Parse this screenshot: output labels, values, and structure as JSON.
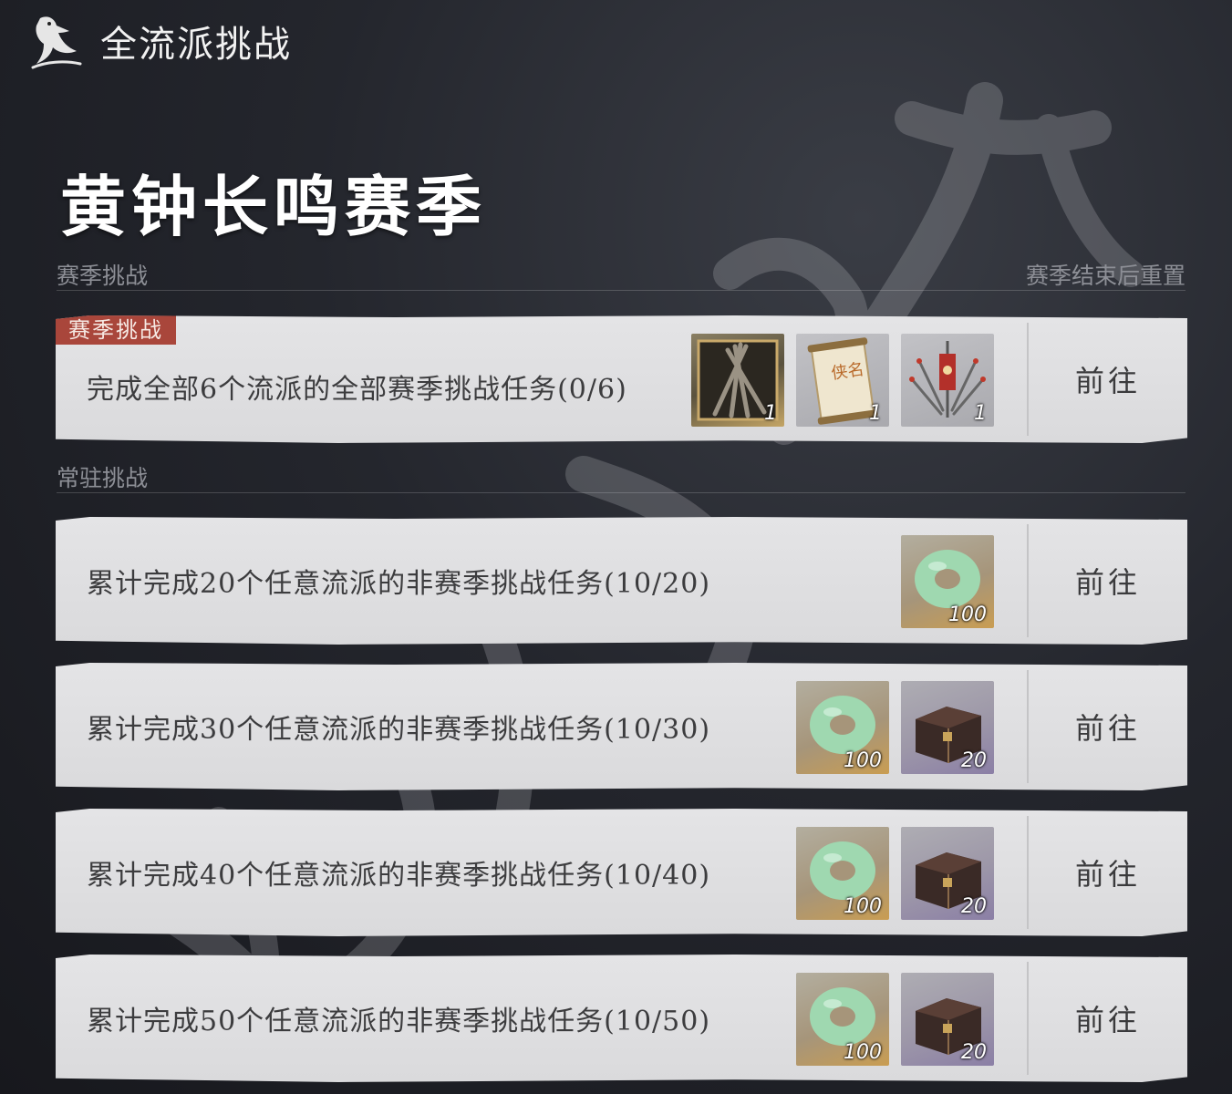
{
  "app": {
    "title": "全流派挑战",
    "logo_icon": "crow-logo-icon"
  },
  "season": {
    "title": "黄钟长鸣赛季"
  },
  "season_section": {
    "label": "赛季挑战",
    "note": "赛季结束后重置"
  },
  "permanent_section": {
    "label": "常驻挑战"
  },
  "season_challenge": {
    "tag": "赛季挑战",
    "description": "完成全部6个流派的全部赛季挑战任务(0/6)",
    "progress": {
      "current": 0,
      "total": 6
    },
    "rewards": [
      {
        "icon": "weapon-set-icon",
        "count": "1"
      },
      {
        "icon": "scroll-icon",
        "count": "1",
        "scroll_text": "侠名"
      },
      {
        "icon": "banner-weapons-icon",
        "count": "1"
      }
    ],
    "button": "前往"
  },
  "permanent_challenges": [
    {
      "description": "累计完成20个任意流派的非赛季挑战任务(10/20)",
      "progress": {
        "current": 10,
        "total": 20
      },
      "rewards": [
        {
          "icon": "jade-ring-icon",
          "count": "100"
        }
      ],
      "button": "前往"
    },
    {
      "description": "累计完成30个任意流派的非赛季挑战任务(10/30)",
      "progress": {
        "current": 10,
        "total": 30
      },
      "rewards": [
        {
          "icon": "jade-ring-icon",
          "count": "100"
        },
        {
          "icon": "treasure-chest-icon",
          "count": "20"
        }
      ],
      "button": "前往"
    },
    {
      "description": "累计完成40个任意流派的非赛季挑战任务(10/40)",
      "progress": {
        "current": 10,
        "total": 40
      },
      "rewards": [
        {
          "icon": "jade-ring-icon",
          "count": "100"
        },
        {
          "icon": "treasure-chest-icon",
          "count": "20"
        }
      ],
      "button": "前往"
    },
    {
      "description": "累计完成50个任意流派的非赛季挑战任务(10/50)",
      "progress": {
        "current": 10,
        "total": 50
      },
      "rewards": [
        {
          "icon": "jade-ring-icon",
          "count": "100"
        },
        {
          "icon": "treasure-chest-icon",
          "count": "20"
        }
      ],
      "button": "前往"
    }
  ],
  "colors": {
    "tag_bg": "#a9463b",
    "card_bg": "#e2e2e4",
    "page_bg": "#1d1e24"
  }
}
